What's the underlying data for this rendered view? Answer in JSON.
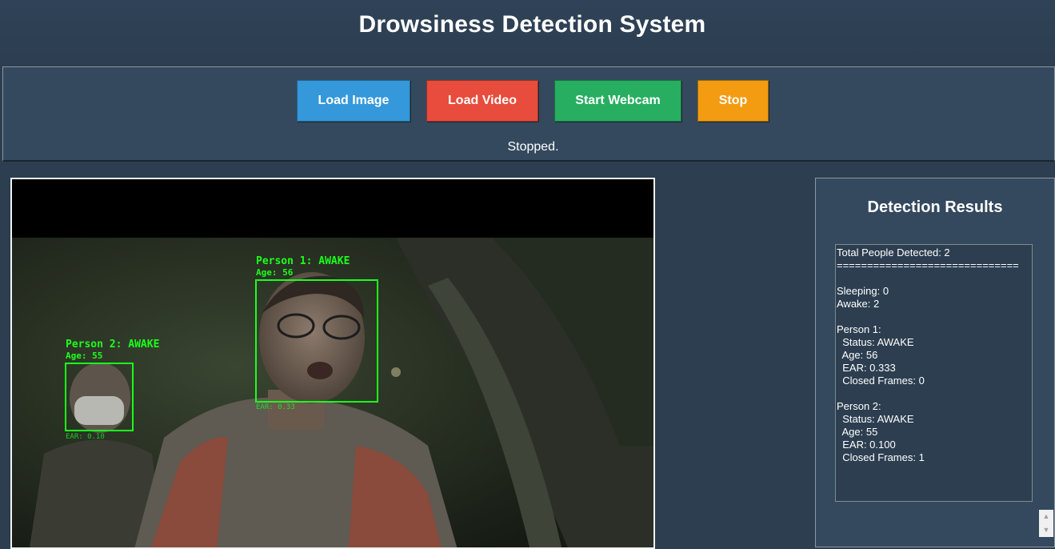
{
  "app": {
    "title": "Drowsiness Detection System"
  },
  "controls": {
    "load_image": "Load Image",
    "load_video": "Load Video",
    "start_webcam": "Start Webcam",
    "stop": "Stop",
    "status": "Stopped."
  },
  "video": {
    "person1": {
      "label": "Person 1: AWAKE",
      "age": "Age: 56",
      "ear": "EAR: 0.33"
    },
    "person2": {
      "label": "Person 2: AWAKE",
      "age": "Age: 55",
      "ear": "EAR: 0.10"
    }
  },
  "results": {
    "title": "Detection Results",
    "lines": [
      "Total People Detected: 2",
      "==============================",
      "",
      "Sleeping: 0",
      "Awake: 2",
      "",
      "Person 1:",
      "  Status: AWAKE",
      "  Age: 56",
      "  EAR: 0.333",
      "  Closed Frames: 0",
      "",
      "Person 2:",
      "  Status: AWAKE",
      "  Age: 55",
      "  EAR: 0.100",
      "  Closed Frames: 1"
    ]
  },
  "colors": {
    "background": "#2c3e50",
    "panel": "#34495e",
    "load_image": "#3498db",
    "load_video": "#e74c3c",
    "start_webcam": "#27ae60",
    "stop": "#f39c12",
    "detection_overlay": "#1cff1c"
  }
}
